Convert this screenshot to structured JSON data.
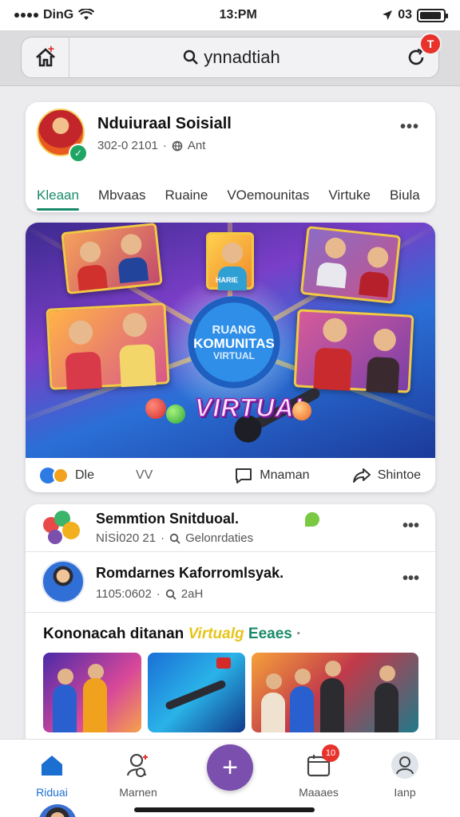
{
  "status_bar": {
    "carrier": "DinG",
    "time": "13:PM",
    "right_text": "03"
  },
  "header": {
    "search_text": "ynnadtiah",
    "notification_count": "T"
  },
  "profile": {
    "name": "Nduiuraal Soisiall",
    "meta_date": "302-0 2101",
    "meta_label": "Ant",
    "tabs": [
      "Kleaan",
      "Mbvaas",
      "Ruaine",
      "VOemounitas",
      "Virtuke",
      "Biula"
    ]
  },
  "banner": {
    "center_line1": "RUANG",
    "center_line2": "KOMUNITAS",
    "center_line3": "VIRTUAL",
    "virtual_title": "VIRTUAL",
    "photo_caption": "HARIE",
    "actions": {
      "like_label": "Dle",
      "vv_label": "VV",
      "comment_label": "Mnaman",
      "share_label": "Shintoe"
    }
  },
  "feed": {
    "post1": {
      "title": "Semmtion Snitduoal.",
      "meta_date": "NİSİ020 21",
      "meta_label": "Gelonrdaties"
    },
    "post2": {
      "title": "Romdarnes Kaforromlsyak.",
      "meta_date": "1105:0602",
      "meta_label": "2aH"
    },
    "section": {
      "prefix": "Kononacah ditanan",
      "highlight": "Virtualg",
      "suffix": "Eeaes"
    }
  },
  "bottom_nav": {
    "items": [
      {
        "label": "Riduai"
      },
      {
        "label": "Marnen"
      },
      {
        "label": "Maaaes"
      },
      {
        "label": "Ianp"
      }
    ],
    "badge": "10"
  },
  "colors": {
    "accent_green": "#1a8a6a",
    "fab_purple": "#7a4fae",
    "badge_red": "#e8322c",
    "nav_active_blue": "#1a6fd0"
  },
  "icons": [
    "home-icon",
    "search-icon",
    "refresh-icon",
    "more-icon",
    "comment-icon",
    "share-icon",
    "add-icon",
    "profile-icon",
    "calendar-icon",
    "person-icon"
  ]
}
